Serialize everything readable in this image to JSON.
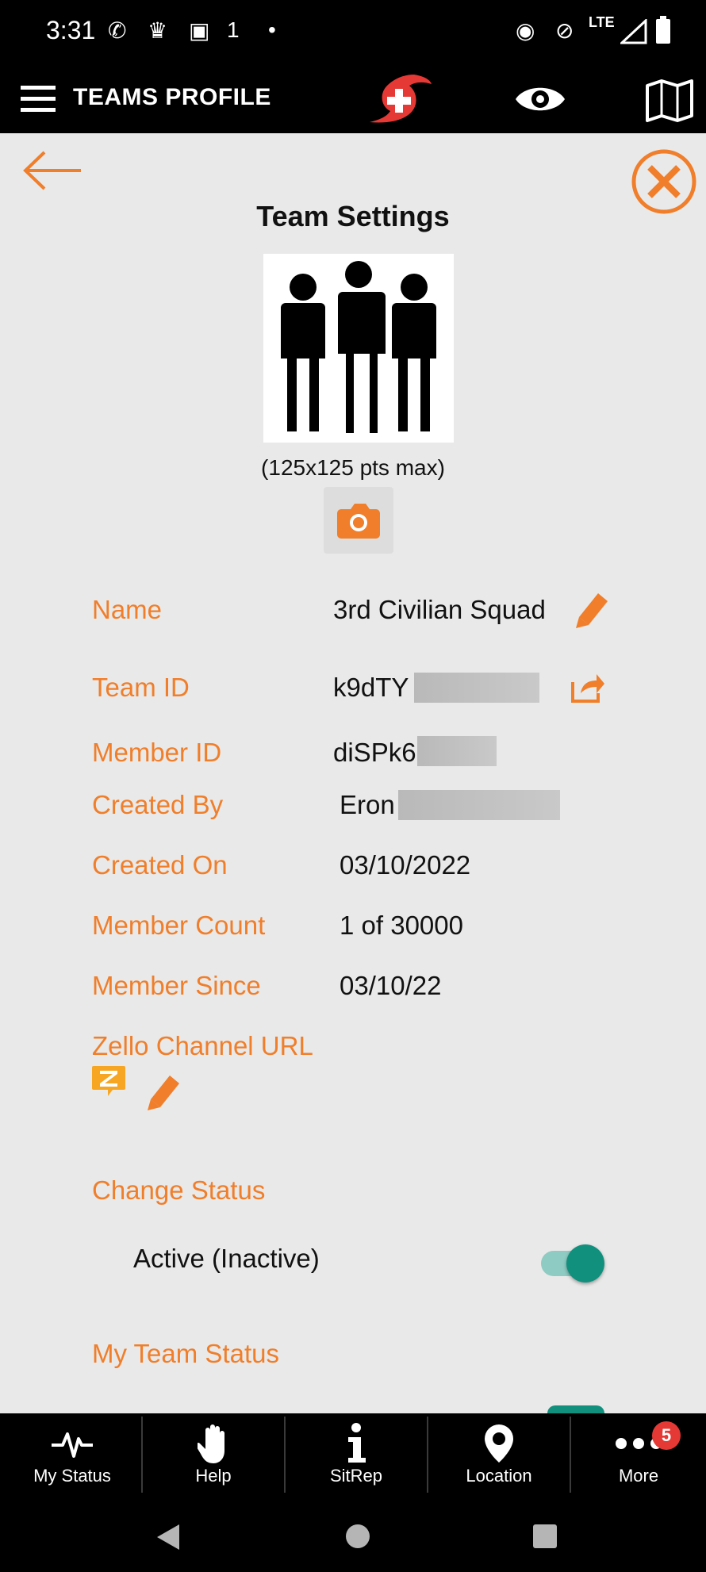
{
  "status_bar": {
    "time": "3:31",
    "left_icons": [
      "missed-call-icon",
      "cake-icon",
      "phone-sync-icon",
      "network-1-icon",
      "dot-icon"
    ],
    "right_icons": [
      "location-icon",
      "bell-off-icon",
      "lte-icon",
      "signal-icon",
      "battery-icon"
    ],
    "lte_label": "LTE"
  },
  "app_bar": {
    "title": "TEAMS PROFILE",
    "icons": [
      "menu-icon",
      "app-logo-icon",
      "eye-icon",
      "map-icon"
    ]
  },
  "page": {
    "heading": "Team Settings",
    "image_caption": "(125x125 pts max)"
  },
  "fields": [
    {
      "label": "Name",
      "value": "3rd Civilian Squad"
    },
    {
      "label": "Team ID",
      "value": "k9dTY"
    },
    {
      "label": "Member ID",
      "value": "diSPk6"
    },
    {
      "label": "Created By",
      "value": "Eron"
    },
    {
      "label": "Created On",
      "value": "03/10/2022"
    },
    {
      "label": "Member Count",
      "value": "1 of 30000"
    },
    {
      "label": "Member Since",
      "value": "03/10/22"
    }
  ],
  "zello": {
    "label": "Zello Channel URL"
  },
  "change_status": {
    "heading": "Change Status",
    "toggle_label": "Active (Inactive)",
    "toggle_on": true
  },
  "my_team_status": {
    "heading": "My Team Status"
  },
  "bottom_nav": [
    {
      "label": "My Status",
      "icon": "heartbeat-icon"
    },
    {
      "label": "Help",
      "icon": "hand-icon"
    },
    {
      "label": "SitRep",
      "icon": "info-icon"
    },
    {
      "label": "Location",
      "icon": "location-pin-icon"
    },
    {
      "label": "More",
      "icon": "more-icon",
      "badge": "5"
    }
  ],
  "colors": {
    "accent": "#f07e2a",
    "toggle": "#12907e",
    "bar": "#000000",
    "background": "#e9e9e9",
    "logo_red": "#e53935"
  }
}
